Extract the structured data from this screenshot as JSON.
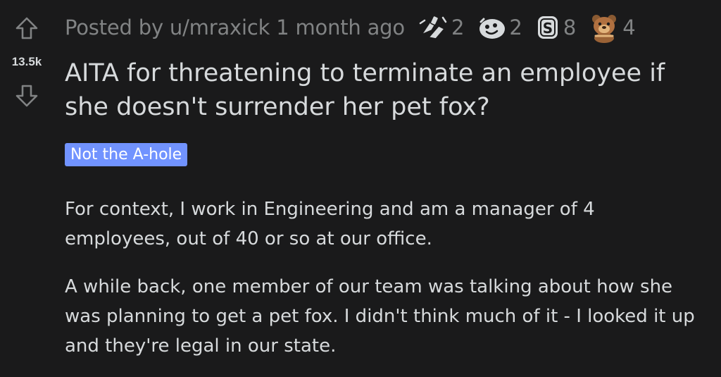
{
  "post": {
    "score": "13.5k",
    "meta": "Posted by u/mraxick 1 month ago",
    "awards": [
      {
        "icon": "handshake-award-icon",
        "count": "2"
      },
      {
        "icon": "wholesome-award-icon",
        "count": "2"
      },
      {
        "icon": "silver-award-icon",
        "count": "8"
      },
      {
        "icon": "bear-award-icon",
        "count": "4"
      }
    ],
    "title": "AITA for threatening to terminate an employee if she doesn't surrender her pet fox?",
    "flair": "Not the A-hole",
    "flair_color": "#7193ff",
    "paragraphs": [
      "For context, I work in Engineering and am a manager of 4 employees, out of 40 or so at our office.",
      "A while back, one member of our team was talking about how she was planning to get a pet fox. I didn't think much of it - I looked it up and they're legal in our state."
    ]
  },
  "colors": {
    "background": "#1a1a1b",
    "text": "#d7dadc",
    "muted": "#818384"
  }
}
